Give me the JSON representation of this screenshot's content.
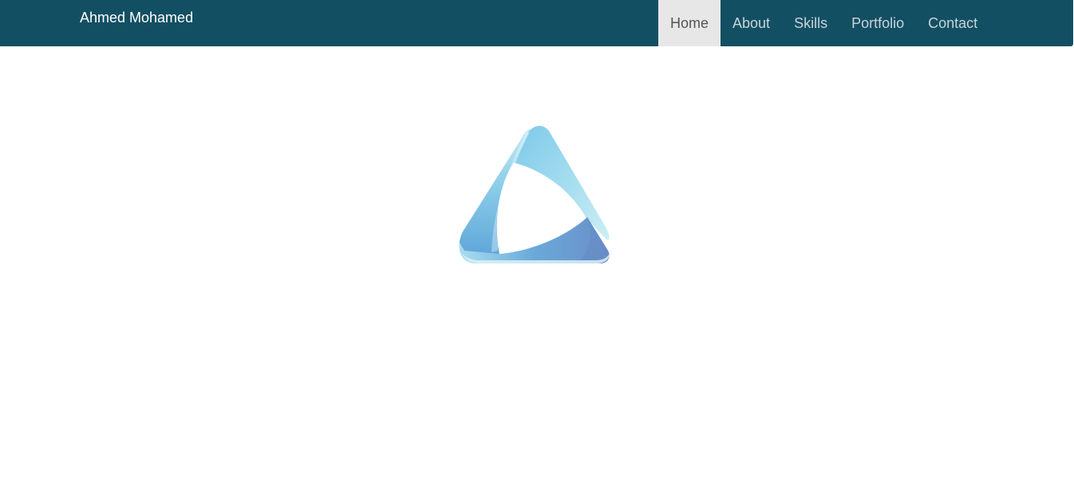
{
  "navbar": {
    "brand": "Ahmed Mohamed",
    "items": [
      {
        "label": "Home",
        "active": true
      },
      {
        "label": "About",
        "active": false
      },
      {
        "label": "Skills",
        "active": false
      },
      {
        "label": "Portfolio",
        "active": false
      },
      {
        "label": "Contact",
        "active": false
      }
    ]
  },
  "hero": {
    "logo_icon": "triangle-ribbon-logo-icon"
  },
  "colors": {
    "navbar_bg": "#134f63",
    "active_bg": "#e7e7e7",
    "active_text": "#555555",
    "nav_text": "#c8d4d9",
    "brand_text": "#ffffff"
  }
}
